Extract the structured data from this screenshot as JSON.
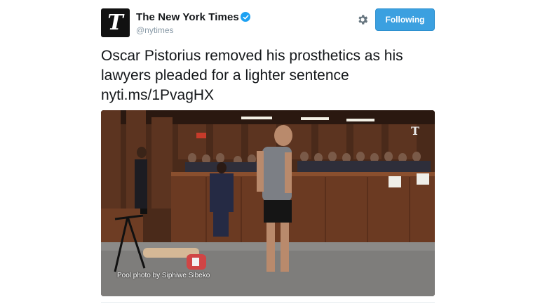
{
  "account": {
    "display_name": "The New York Times",
    "handle": "@nytimes",
    "avatar_glyph": "T",
    "verified": true
  },
  "actions": {
    "follow_label": "Following",
    "settings_icon": "gear-icon"
  },
  "tweet": {
    "text": "Oscar Pistorius removed his prosthetics as his lawyers pleaded for a lighter sentence",
    "link": "nyti.ms/1PvagHX"
  },
  "media": {
    "photo_credit": "Pool photo by Siphiwe Sibeko",
    "watermark_glyph": "T"
  },
  "colors": {
    "follow_button": "#3ba0e0",
    "verified_badge": "#1da1f2",
    "handle_text": "#8899a6"
  }
}
